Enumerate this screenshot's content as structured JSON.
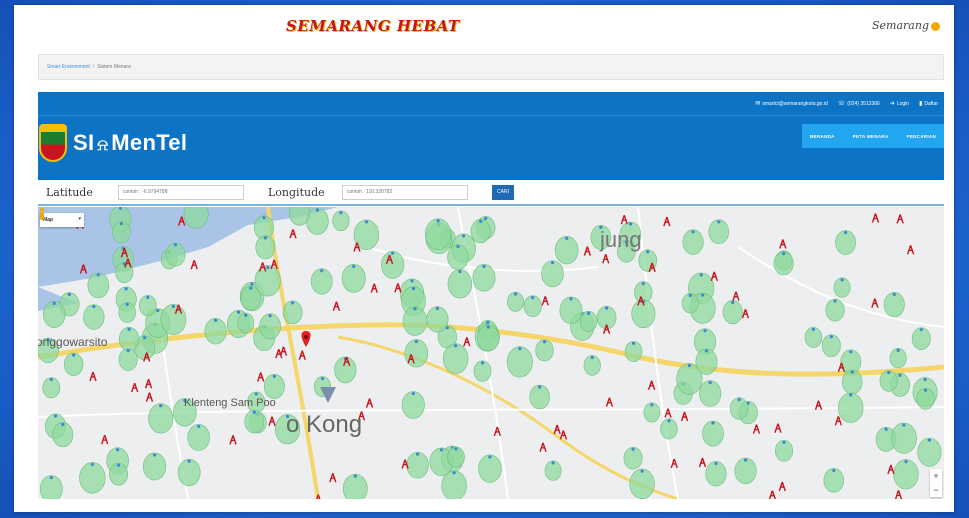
{
  "brand": {
    "slogan": "SEMARANG HEBAT",
    "city_logo": "Semarang"
  },
  "breadcrumb": {
    "link": "Smart Environment",
    "current": "Sistem Menara"
  },
  "header": {
    "email": "smartct@semarangkota.go.id",
    "phone": "(024) 3513366",
    "login_label": "Login",
    "register_label": "Daftar",
    "app_name_prefix": "SI",
    "app_name_suffix": "MenTel",
    "nav": [
      "BERANDA",
      "PETA MENARA",
      "PENCARIAN"
    ]
  },
  "search": {
    "latitude_label": "Latitude",
    "latitude_placeholder": "contoh : -6.9794788",
    "longitude_label": "Longitude",
    "longitude_placeholder": "contoh : 110.328782",
    "button_label": "CARI"
  },
  "map": {
    "type_control": "Map",
    "labels": {
      "district_north_east": "jung",
      "district_west": "onggowarsito",
      "temple": "Klenteng Sam Poo",
      "district_center": "o Kong"
    },
    "zoom_in": "+",
    "zoom_out": "−",
    "colors": {
      "coverage": "#8fd99d",
      "tower": "#c8141e",
      "marker": "#e02020",
      "roads": "#f5d66a"
    }
  }
}
